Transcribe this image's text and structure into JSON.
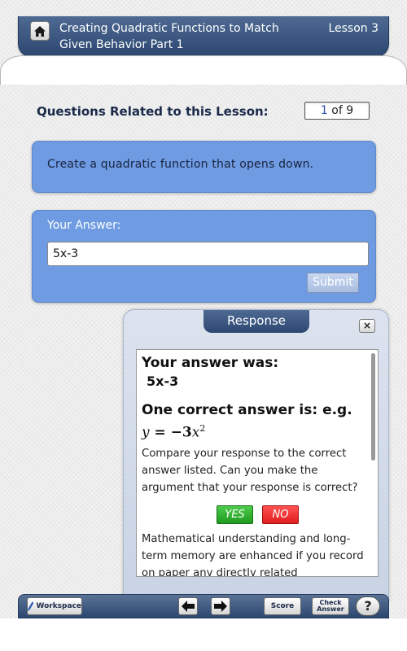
{
  "header": {
    "title": "Creating Quadratic Functions to Match Given Behavior Part 1",
    "lesson": "Lesson 3",
    "home_icon": "home-icon"
  },
  "questions": {
    "heading": "Questions Related to this Lesson:",
    "current": "1",
    "of_text": "of 9"
  },
  "question": {
    "text": "Create a quadratic function that opens down."
  },
  "answer": {
    "label": "Your Answer:",
    "value": "5x-3",
    "submit_label": "Submit"
  },
  "response": {
    "tab_label": "Response",
    "close_label": "×",
    "your_answer_heading": "Your answer was:",
    "your_answer_value": "5x-3",
    "correct_heading": "One correct answer is:  e.g.",
    "formula_lhs": "y",
    "formula_eq": " = −3",
    "formula_var": "x",
    "formula_exp": "2",
    "compare_text": "Compare your response to the correct answer listed. Can you make the argument that your response is correct?",
    "yes_label": "YES",
    "no_label": "NO",
    "memory_text": "Mathematical understanding and long-term memory are enhanced if you record on paper any directly related mathematics in"
  },
  "toolbar": {
    "workspace_label": "Workspace",
    "score_label": "Score",
    "check_answer_label": "Check Answer",
    "help_label": "?"
  },
  "colors": {
    "header_blue": "#2c4770",
    "panel_blue": "#6e9be2",
    "yes_green": "#1f9b1f",
    "no_red": "#e11d1d"
  }
}
